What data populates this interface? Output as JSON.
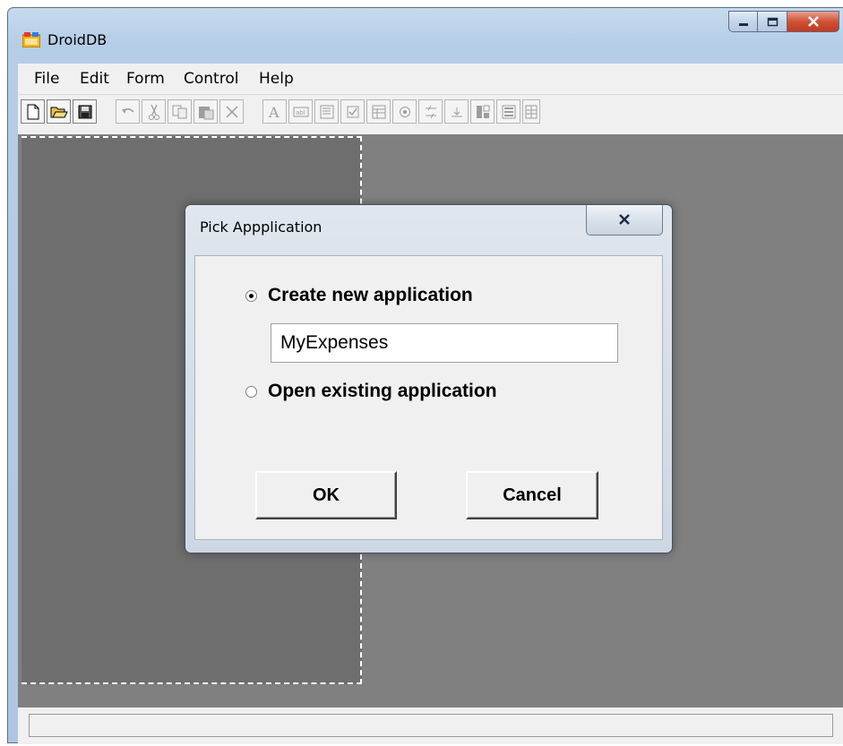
{
  "window": {
    "title": "DroidDB"
  },
  "menu": [
    "File",
    "Edit",
    "Form",
    "Control",
    "Help"
  ],
  "toolbar": {
    "buttons": [
      "new-icon",
      "open-icon",
      "save-icon",
      "undo-icon",
      "cut-icon",
      "copy-icon",
      "paste-icon",
      "delete-icon",
      "label-tool-icon",
      "textbox-tool-icon",
      "listbox-tool-icon",
      "checkbox-tool-icon",
      "grid-tool-icon",
      "radio-tool-icon",
      "spinner-tool-icon",
      "align-tool-icon",
      "layout-tool-icon",
      "form-tool-icon",
      "table-tool-icon"
    ]
  },
  "dialog": {
    "title": "Pick Appplication",
    "option_new": "Create new application",
    "option_existing": "Open existing application",
    "name_value": "MyExpenses",
    "selected": "new",
    "ok_label": "OK",
    "cancel_label": "Cancel"
  },
  "statusbar": {
    "text": ""
  },
  "colors": {
    "workspace": "#808080",
    "designer": "#6e6e6e",
    "close_button": "#c2391d"
  }
}
